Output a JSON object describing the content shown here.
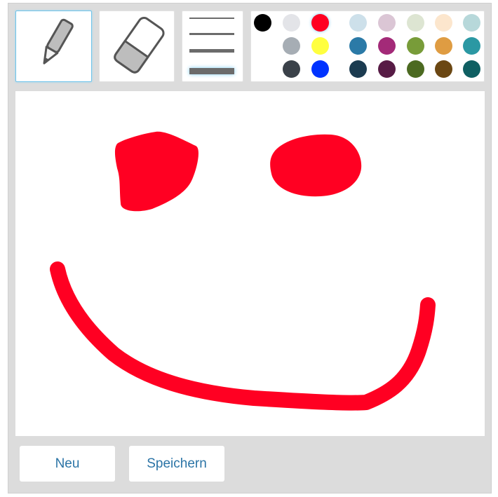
{
  "toolbar": {
    "pencil": {
      "icon": "pencil-icon",
      "selected": true
    },
    "eraser": {
      "icon": "eraser-icon",
      "selected": false
    },
    "stroke_widths": {
      "options": [
        1,
        2,
        3,
        4
      ],
      "selected_index": 3
    }
  },
  "palette": {
    "selected_color": "#ff0022",
    "colors": [
      "#000000",
      "#e3e4e8",
      "#ff0022",
      "#cde0ea",
      "#dbc6d5",
      "#dde5d2",
      "#fce6cd",
      "#b7d8da",
      "#ffffff",
      "#a6adb4",
      "#ffff3f",
      "#2b7aa7",
      "#a32a78",
      "#789c39",
      "#df9c42",
      "#2b98a3",
      "#3a4149",
      "#0033ff",
      "#1b3b50",
      "#571b45",
      "#4c6a21",
      "#6b4713",
      "#0f5f62"
    ]
  },
  "canvas": {
    "stroke_color": "#ff0022",
    "background": "#ffffff"
  },
  "actions": {
    "new_label": "Neu",
    "save_label": "Speichern"
  }
}
